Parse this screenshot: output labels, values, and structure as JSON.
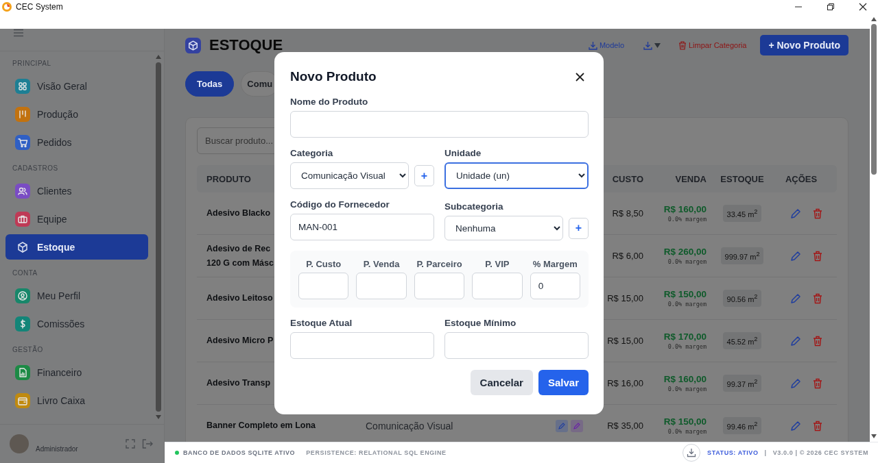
{
  "window": {
    "title": "CEC System"
  },
  "sidebar": {
    "sections": [
      {
        "title": "PRINCIPAL",
        "items": [
          {
            "label": "Visão Geral",
            "selected": false,
            "color": "#1d7f94"
          },
          {
            "label": "Produção",
            "selected": false,
            "color": "#c2720f"
          },
          {
            "label": "Pedidos",
            "selected": false,
            "color": "#2f5fc4"
          }
        ]
      },
      {
        "title": "CADASTROS",
        "items": [
          {
            "label": "Clientes",
            "selected": false,
            "color": "#7a4cc4"
          },
          {
            "label": "Equipe",
            "selected": false,
            "color": "#bf3a56"
          },
          {
            "label": "Estoque",
            "selected": true
          }
        ]
      },
      {
        "title": "CONTA",
        "items": [
          {
            "label": "Meu Perfil",
            "selected": false,
            "color": "#17876a"
          },
          {
            "label": "Comissões",
            "selected": false,
            "color": "#138578"
          }
        ]
      },
      {
        "title": "GESTÃO",
        "items": [
          {
            "label": "Financeiro",
            "selected": false,
            "color": "#1c8a45"
          },
          {
            "label": "Livro Caixa",
            "selected": false,
            "color": "#c08a10"
          }
        ]
      }
    ],
    "user": {
      "name": "Administrador"
    }
  },
  "header": {
    "title": "ESTOQUE",
    "actions": [
      {
        "kind": "link",
        "label": "Modelo"
      },
      {
        "kind": "dropdown"
      },
      {
        "kind": "danger",
        "label": "Limpar Categoria"
      },
      {
        "kind": "primary",
        "label": "+ Novo Produto"
      }
    ]
  },
  "filters": [
    {
      "label": "Todas",
      "selected": true
    },
    {
      "label": "Comu",
      "selected": false
    }
  ],
  "search": {
    "placeholder": "Buscar produto..."
  },
  "table": {
    "columns": [
      "PRODUTO",
      "CUSTO",
      "VENDA",
      "ESTOQUE",
      "AÇÕES"
    ],
    "rows": [
      {
        "name": "Adesivo Blacko",
        "cost": "R$ 8,50",
        "price": "R$ 160,00",
        "margin": "0.0% margem",
        "stock": "33.45 m$^{2}$"
      },
      {
        "name": "Adesivo de Rec\n120 G com Másc",
        "cost": "R$ 6,00",
        "price": "R$ 260,00",
        "margin": "0.0% margem",
        "stock": "999.97 m$^{2}$"
      },
      {
        "name": "Adesivo Leitoso",
        "cost": "R$ 15,00",
        "price": "R$ 150,00",
        "margin": "0.0% margem",
        "stock": "90.56 m$^{2}$"
      },
      {
        "name": "Adesivo Micro P",
        "cost": "R$ 15,00",
        "price": "R$ 170,00",
        "margin": "0.0% margem",
        "stock": "45.52 m$^{2}$"
      },
      {
        "name": "Adesivo Transp",
        "cost": "R$ 16,00",
        "price": "R$ 160,00",
        "margin": "0.0% margem",
        "stock": "99.37 m$^{2}$"
      },
      {
        "name": "Banner Completo em Lona",
        "category": "Comunicação Visual",
        "cost": "R$ 35,00",
        "price": "R$ 150,00",
        "margin": "0.0% margem",
        "stock": "99.46 m$^{2}$"
      }
    ]
  },
  "modal": {
    "title": "Novo Produto",
    "name_field": {
      "label": "Nome do Produto"
    },
    "category": {
      "label": "Categoria",
      "value": "Comunicação Visual",
      "add": "+"
    },
    "unit": {
      "label": "Unidade",
      "value": "Unidade (un)",
      "focused": true
    },
    "supplier_code": {
      "label": "Código do Fornecedor",
      "value": "MAN-001"
    },
    "subcategory": {
      "label": "Subcategoria",
      "value": "Nenhuma",
      "add": "+"
    },
    "prices": [
      {
        "label": "P. Custo"
      },
      {
        "label": "P. Venda"
      },
      {
        "label": "P. Parceiro"
      },
      {
        "label": "P. VIP"
      },
      {
        "label": "% Margem",
        "value": "0"
      }
    ],
    "stock": [
      {
        "label": "Estoque Atual"
      },
      {
        "label": "Estoque Mínimo"
      }
    ],
    "buttons": [
      {
        "kind": "secondary",
        "label": "Cancelar"
      },
      {
        "kind": "primary",
        "label": "Salvar"
      }
    ]
  },
  "status_bar": {
    "db_status": "BANCO DE DADOS SQLITE ATIVO",
    "persistence": "PERSISTENCE: RELATIONAL SQL ENGINE",
    "status": "STATUS: ATIVO",
    "separator": "|",
    "version": "V3.0.0 | © 2026 CEC SYSTEM"
  }
}
